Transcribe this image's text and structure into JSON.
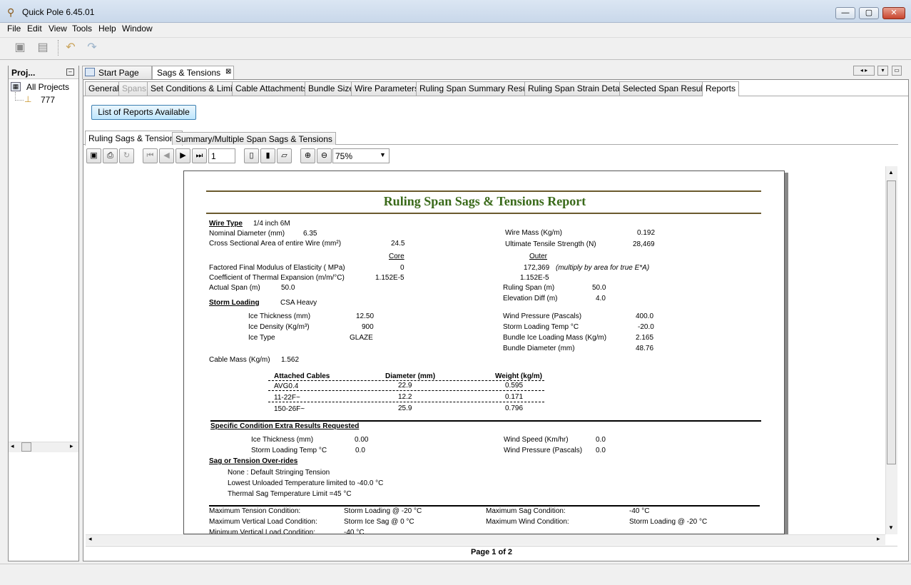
{
  "window": {
    "title": "Quick Pole 6.45.01",
    "min_glyph": "—",
    "max_glyph": "▢",
    "close_glyph": "✕"
  },
  "menu": [
    "File",
    "Edit",
    "View",
    "Tools",
    "Help",
    "Window"
  ],
  "projects": {
    "header": "Proj...",
    "root": "All Projects",
    "item": "777"
  },
  "doc_tabs": {
    "start": "Start Page",
    "sags": "Sags & Tensions",
    "close": "⊠"
  },
  "sub_tabs": [
    "General",
    "Spans",
    "Set Conditions & Limits",
    "Cable Attachments",
    "Bundle Size",
    "Wire Parameters",
    "Ruling Span Summary Results",
    "Ruling Span Strain Details",
    "Selected Span Results",
    "Reports"
  ],
  "list_reports_button": "List of Reports Available",
  "report_tabs": [
    "Ruling Sags & Tensions",
    "Summary/Multiple Span Sags & Tensions"
  ],
  "viewer": {
    "page_input": "1",
    "zoom": "75%",
    "page_status": "Page 1 of 2"
  },
  "report": {
    "title": "Ruling Span Sags & Tensions Report",
    "wire_type_label": "Wire Type",
    "wire_type": "1/4 inch 6M",
    "nominal_diameter_label": "Nominal Diameter (mm)",
    "nominal_diameter": "6.35",
    "cross_section_label": "Cross Sectional Area of entire Wire (mm²)",
    "cross_section": "24.5",
    "wire_mass_label": "Wire Mass (Kg/m)",
    "wire_mass": "0.192",
    "uts_label": "Ultimate Tensile Strength (N)",
    "uts": "28,469",
    "core": "Core",
    "outer": "Outer",
    "modulus_label": "Factored Final Modulus of Elasticity ( MPa)",
    "modulus_core": "0",
    "modulus_outer": "172,369",
    "modulus_note": "(multiply by area for true E*A)",
    "thermal_label": "Coefficient of Thermal Expansion (m/m/°C)",
    "thermal_core": "1.152E-5",
    "thermal_outer": "1.152E-5",
    "actual_span_label": "Actual Span (m)",
    "actual_span": "50.0",
    "ruling_span_label": "Ruling Span (m)",
    "ruling_span": "50.0",
    "elevation_label": "Elevation Diff (m)",
    "elevation": "4.0",
    "storm_label": "Storm Loading",
    "storm": "CSA Heavy",
    "ice_thickness_label": "Ice Thickness (mm)",
    "ice_thickness": "12.50",
    "ice_density_label": "Ice Density (Kg/m³)",
    "ice_density": "900",
    "ice_type_label": "Ice Type",
    "ice_type": "GLAZE",
    "wind_pressure_label": "Wind Pressure (Pascals)",
    "wind_pressure": "400.0",
    "storm_temp_label": "Storm Loading Temp °C",
    "storm_temp": "-20.0",
    "bundle_ice_label": "Bundle Ice Loading Mass (Kg/m)",
    "bundle_ice": "2.165",
    "bundle_diam_label": "Bundle Diameter (mm)",
    "bundle_diam": "48.76",
    "cable_mass_label": "Cable Mass (Kg/m)",
    "cable_mass": "1.562",
    "cables_headers": [
      "Attached Cables",
      "Diameter (mm)",
      "Weight (kg/m)"
    ],
    "cables": [
      {
        "name": "AVG0.4",
        "diameter": "22.9",
        "weight": "0.595"
      },
      {
        "name": "11-22F~",
        "diameter": "12.2",
        "weight": "0.171"
      },
      {
        "name": "150-26F~",
        "diameter": "25.9",
        "weight": "0.796"
      }
    ],
    "specific_label": "Specific Condition Extra Results Requested",
    "sc_ice_label": "Ice Thickness (mm)",
    "sc_ice": "0.00",
    "sc_temp_label": "Storm Loading Temp °C",
    "sc_temp": "0.0",
    "sc_wind_speed_label": "Wind Speed (Km/hr)",
    "sc_wind_speed": "0.0",
    "sc_wind_pressure_label": "Wind Pressure (Pascals)",
    "sc_wind_pressure": "0.0",
    "override_label": "Sag or Tension Over-rides",
    "override_lines": [
      "None : Default Stringing Tension",
      "Lowest Unloaded Temperature limited to -40.0 °C",
      "Thermal Sag Temperature Limit =45 °C"
    ],
    "max_tension_label": "Maximum Tension Condition:",
    "max_tension": "Storm Loading @ -20 °C",
    "max_sag_label": "Maximum Sag Condition:",
    "max_sag": "-40 °C",
    "max_vert_label": "Maximum Vertical Load Condition:",
    "max_vert": "Storm Ice Sag @ 0 °C",
    "max_wind_label": "Maximum Wind Condition:",
    "max_wind": "Storm Loading @ -20 °C",
    "min_vert_label": "Minimum Vertical Load Condition:",
    "min_vert": "-40 °C"
  }
}
